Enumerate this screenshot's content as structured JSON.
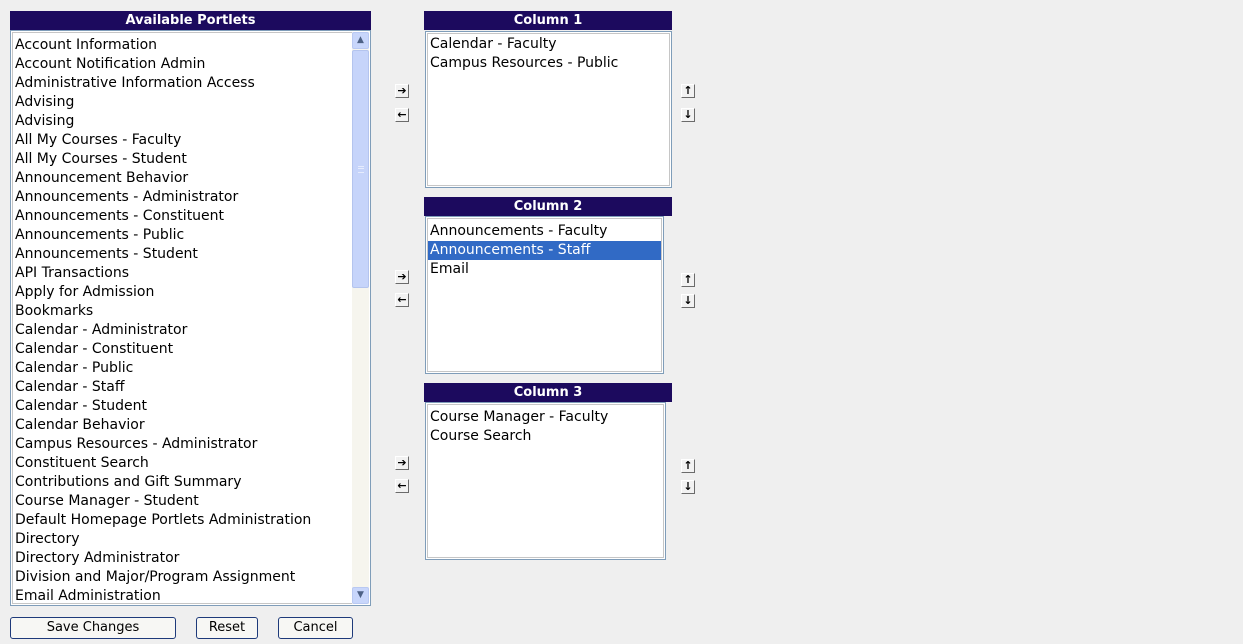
{
  "available": {
    "title": "Available Portlets",
    "items": [
      "Account Information",
      "Account Notification Admin",
      "Administrative Information Access",
      "Advising",
      "Advising",
      "All My Courses - Faculty",
      "All My Courses - Student",
      "Announcement Behavior",
      "Announcements - Administrator",
      "Announcements - Constituent",
      "Announcements - Public",
      "Announcements - Student",
      "API Transactions",
      "Apply for Admission",
      "Bookmarks",
      "Calendar - Administrator",
      "Calendar - Constituent",
      "Calendar - Public",
      "Calendar - Staff",
      "Calendar - Student",
      "Calendar Behavior",
      "Campus Resources - Administrator",
      "Constituent Search",
      "Contributions and Gift Summary",
      "Course Manager - Student",
      "Default Homepage Portlets Administration",
      "Directory",
      "Directory Administrator",
      "Division and Major/Program Assignment",
      "Email Administration"
    ]
  },
  "columns": [
    {
      "title": "Column 1",
      "items": [
        "Calendar - Faculty",
        "Campus Resources - Public"
      ],
      "selected": -1
    },
    {
      "title": "Column 2",
      "items": [
        "Announcements - Faculty",
        "Announcements - Staff",
        "Email"
      ],
      "selected": 1
    },
    {
      "title": "Column 3",
      "items": [
        "Course Manager - Faculty",
        "Course Search"
      ],
      "selected": -1
    }
  ],
  "arrows": {
    "add": "➔",
    "remove": "←",
    "up": "↑",
    "down": "↓",
    "scroll_up": "▲",
    "scroll_down": "▼"
  },
  "buttons": {
    "save": "Save Changes",
    "reset": "Reset",
    "cancel": "Cancel"
  }
}
